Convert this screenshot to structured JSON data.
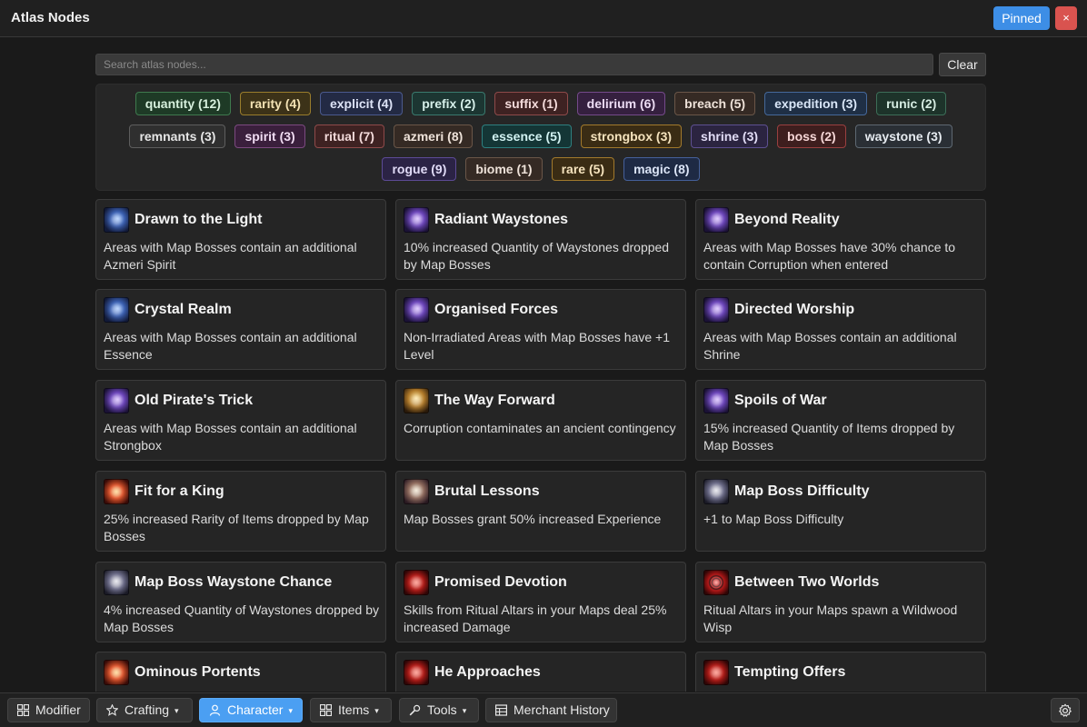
{
  "app": {
    "title": "Atlas Nodes",
    "pinned_label": "Pinned",
    "close_label": "×"
  },
  "search": {
    "placeholder": "Search atlas nodes...",
    "clear_label": "Clear"
  },
  "tags": [
    [
      "quantity (12)",
      "rarity (4)",
      "explicit (4)",
      "prefix (2)",
      "suffix (1)",
      "delirium (6)",
      "breach (5)",
      "expedition (3)",
      "runic (2)"
    ],
    [
      "remnants (3)",
      "spirit (3)",
      "ritual (7)",
      "azmeri (8)",
      "essence (5)",
      "strongbox (3)",
      "shrine (3)",
      "boss (2)",
      "waystone (3)"
    ],
    [
      "rogue (9)",
      "biome (1)",
      "rare (5)",
      "magic (8)"
    ]
  ],
  "tag_colors": {
    "quantity": "#3f7a4e",
    "rarity": "#9a7d2c",
    "explicit": "#4b5a8e",
    "prefix": "#3a7a6e",
    "suffix": "#8e4a4a",
    "delirium": "#754a8a",
    "breach": "#6a5648",
    "expedition": "#45689a",
    "runic": "#3c6e58",
    "remnants": "#5e5e5e",
    "spirit": "#7c4a80",
    "ritual": "#8e4a4a",
    "azmeri": "#6a5648",
    "essence": "#2e8080",
    "strongbox": "#a27a2c",
    "shrine": "#5e5090",
    "boss": "#9a4040",
    "waystone": "#5e6872",
    "rogue": "#5c4a96",
    "biome": "#6a5648",
    "rare": "#a27a2c",
    "magic": "#45609a"
  },
  "cards": [
    {
      "title": "Drawn to the Light",
      "description": "Areas with Map Bosses contain an additional Azmeri Spirit",
      "icon": "blue-light-icon"
    },
    {
      "title": "Radiant Waystones",
      "description": "10% increased Quantity of Waystones dropped by Map Bosses",
      "icon": "violet-waystone-icon"
    },
    {
      "title": "Beyond Reality",
      "description": "Areas with Map Bosses have 30% chance to contain Corruption when entered",
      "icon": "violet-figure-icon"
    },
    {
      "title": "Crystal Realm",
      "description": "Areas with Map Bosses contain an additional Essence",
      "icon": "crystal-icon"
    },
    {
      "title": "Organised Forces",
      "description": "Non-Irradiated Areas with Map Bosses have +1 Level",
      "icon": "violet-forces-icon"
    },
    {
      "title": "Directed Worship",
      "description": "Areas with Map Bosses contain an additional Shrine",
      "icon": "shrine-icon"
    },
    {
      "title": "Old Pirate's Trick",
      "description": "Areas with Map Bosses contain an additional Strongbox",
      "icon": "strongbox-icon"
    },
    {
      "title": "The Way Forward",
      "description": "Corruption contaminates an ancient contingency",
      "icon": "gold-path-icon"
    },
    {
      "title": "Spoils of War",
      "description": "15% increased Quantity of Items dropped by Map Bosses",
      "icon": "spoils-icon"
    },
    {
      "title": "Fit for a King",
      "description": "25% increased Rarity of Items dropped by Map Bosses",
      "icon": "crown-fire-icon"
    },
    {
      "title": "Brutal Lessons",
      "description": "Map Bosses grant 50% increased Experience",
      "icon": "bone-icon"
    },
    {
      "title": "Map Boss Difficulty",
      "description": "+1 to Map Boss Difficulty",
      "icon": "boss-difficulty-icon"
    },
    {
      "title": "Map Boss Waystone Chance",
      "description": "4% increased Quantity of Waystones dropped by Map Bosses",
      "icon": "boss-waystone-icon"
    },
    {
      "title": "Promised Devotion",
      "description": "Skills from Ritual Altars in your Maps deal 25% increased Damage",
      "icon": "ritual-altar-icon"
    },
    {
      "title": "Between Two Worlds",
      "description": "Ritual Altars in your Maps spawn a Wildwood Wisp",
      "icon": "ritual-ring-icon"
    },
    {
      "title": "Ominous Portents",
      "description": "",
      "icon": "ominous-icon"
    },
    {
      "title": "He Approaches",
      "description": "",
      "icon": "approach-icon"
    },
    {
      "title": "Tempting Offers",
      "description": "",
      "icon": "offer-icon"
    }
  ],
  "bottom_nav": {
    "modifier": "Modifier",
    "crafting": "Crafting",
    "character": "Character",
    "items": "Items",
    "tools": "Tools",
    "merchant_history": "Merchant History",
    "caret": "▾"
  },
  "colors": {
    "accent": "#4b9ff2",
    "close": "#d9534f",
    "background": "#1a1a1a",
    "card": "#252525"
  }
}
